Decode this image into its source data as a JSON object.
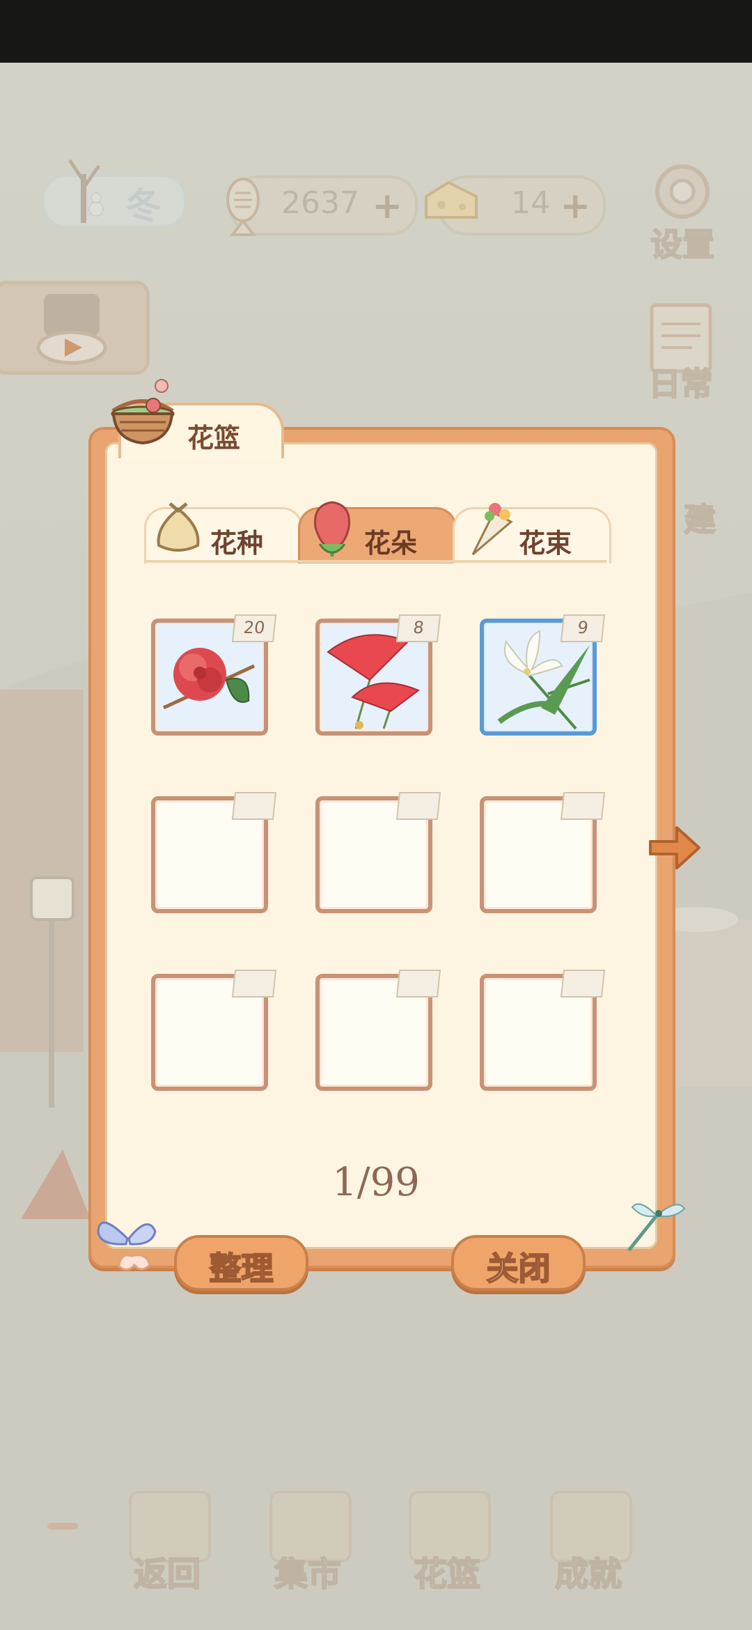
{
  "hud": {
    "season_label": "冬",
    "fish_count": "2637",
    "cheese_count": "14",
    "plus": "+",
    "settings_label": "设置",
    "daily_label": "日常",
    "build_label": "建"
  },
  "bottom_nav": {
    "items": [
      {
        "label": "返回",
        "icon": "window-icon"
      },
      {
        "label": "集市",
        "icon": "market-stall-icon"
      },
      {
        "label": "花篮",
        "icon": "flower-basket-icon"
      },
      {
        "label": "成就",
        "icon": "trophy-icon"
      }
    ]
  },
  "panel": {
    "title": "花篮",
    "tabs": [
      {
        "label": "花种",
        "icon": "seed-bag-icon",
        "active": false
      },
      {
        "label": "花朵",
        "icon": "rose-icon",
        "active": true
      },
      {
        "label": "花束",
        "icon": "bouquet-icon",
        "active": false
      }
    ],
    "slots": [
      {
        "item": "camellia-flower",
        "count": "20"
      },
      {
        "item": "red-fan-flower",
        "count": "8"
      },
      {
        "item": "white-lily",
        "count": "9",
        "highlighted": true
      },
      {
        "item": "",
        "count": ""
      },
      {
        "item": "",
        "count": ""
      },
      {
        "item": "",
        "count": ""
      },
      {
        "item": "",
        "count": ""
      },
      {
        "item": "",
        "count": ""
      },
      {
        "item": "",
        "count": ""
      }
    ],
    "page": "1/99",
    "sort_label": "整理",
    "close_label": "关闭"
  },
  "colors": {
    "panel_border": "#e9a470",
    "panel_fill": "#fdf5e2",
    "slot_border": "#c89276",
    "highlight_border": "#5a9ad6",
    "button_fill": "#efa56a"
  }
}
